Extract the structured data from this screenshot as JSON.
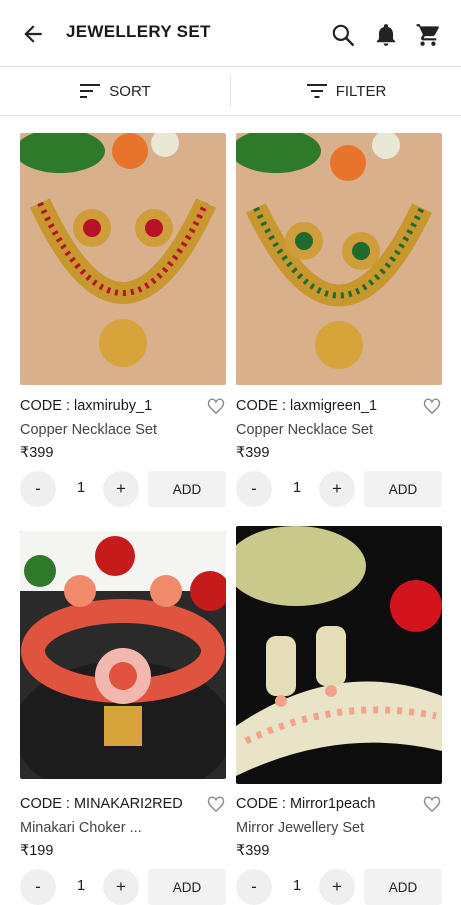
{
  "appbar": {
    "title": "JEWELLERY SET"
  },
  "toolbar": {
    "sort_label": "SORT",
    "filter_label": "FILTER"
  },
  "products": [
    {
      "code": "CODE : laxmiruby_1",
      "name": "Copper Necklace Set",
      "price": "₹399",
      "qty": "1",
      "add_label": "ADD",
      "accent": "#b8112a"
    },
    {
      "code": "CODE : laxmigreen_1",
      "name": "Copper Necklace Set",
      "price": "₹399",
      "qty": "1",
      "add_label": "ADD",
      "accent": "#1f6b2e"
    },
    {
      "code": "CODE : MINAKARI2RED",
      "name": "Minakari Choker ...",
      "price": "₹199",
      "qty": "1",
      "add_label": "ADD",
      "accent": "#e0533f"
    },
    {
      "code": "CODE : Mirror1peach",
      "name": "Mirror Jewellery Set",
      "price": "₹399",
      "qty": "1",
      "add_label": "ADD",
      "accent": "#f2a48a"
    }
  ],
  "icons": {
    "back": "arrow-left-icon",
    "search": "search-icon",
    "notifications": "bell-icon",
    "cart": "cart-icon",
    "wishlist": "heart-outline-icon",
    "sort": "sort-icon",
    "filter": "filter-icon"
  }
}
